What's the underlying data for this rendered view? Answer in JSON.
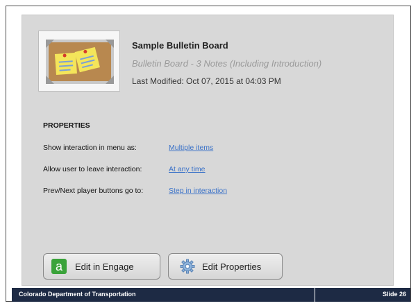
{
  "interaction": {
    "title": "Sample Bulletin Board",
    "subtitle": "Bulletin Board - 3 Notes (Including Introduction)",
    "last_modified": "Last Modified: Oct 07, 2015 at 04:03 PM"
  },
  "properties": {
    "heading": "PROPERTIES",
    "rows": [
      {
        "label": "Show interaction in menu as:",
        "value": "Multiple items"
      },
      {
        "label": "Allow user to leave interaction:",
        "value": "At any time"
      },
      {
        "label": "Prev/Next player buttons go to:",
        "value": "Step in interaction"
      }
    ]
  },
  "buttons": {
    "edit_engage": "Edit in Engage",
    "edit_properties": "Edit Properties"
  },
  "footer": {
    "organization": "Colorado Department of Transportation",
    "slide": "Slide 26"
  },
  "icons": {
    "engage_icon": "letter-a-green-square",
    "properties_icon": "gear",
    "thumbnail": "corkboard-with-sticky-notes"
  },
  "colors": {
    "link": "#3b72c8",
    "footer_bg": "#1d2a44",
    "engage_green": "#3aa33a"
  }
}
